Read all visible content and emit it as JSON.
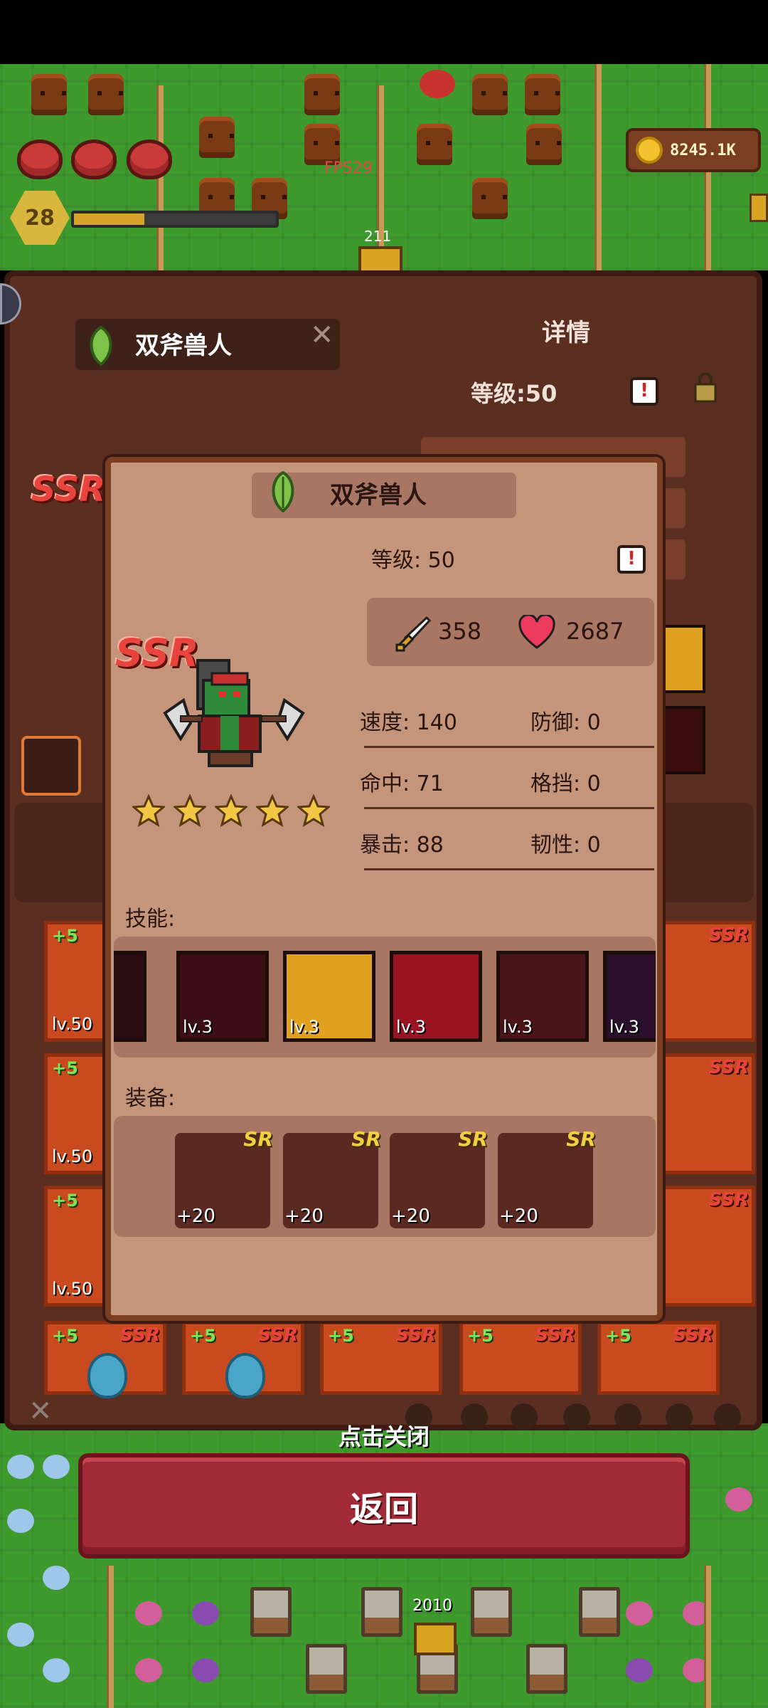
{
  "hud": {
    "fps": "FPS29",
    "player_level": "28",
    "xp_progress": 0.35,
    "coins": "8245.1K",
    "chest_count_top": "211",
    "chest_count_bottom": "2010"
  },
  "back_dialog": {
    "name": "双斧兽人",
    "close_glyph": "✕",
    "details_title": "详情",
    "level": "等级:50",
    "rarity": "SSR",
    "cards": [
      {
        "plus": "+5",
        "lv": "lv.50",
        "rarity": "SSR"
      },
      {
        "plus": "+5",
        "lv": "lv.50",
        "rarity": "SSR"
      },
      {
        "plus": "+5",
        "lv": "lv.50",
        "rarity": "SSR"
      }
    ],
    "bottom_cards": [
      {
        "plus": "+5",
        "rarity": "SSR"
      },
      {
        "plus": "+5",
        "rarity": "SSR"
      },
      {
        "plus": "+5",
        "rarity": "SSR"
      },
      {
        "plus": "+5",
        "rarity": "SSR"
      },
      {
        "plus": "+5",
        "rarity": "SSR"
      }
    ],
    "filter_close": "✕"
  },
  "hero_card": {
    "name": "双斧兽人",
    "rarity": "SSR",
    "level": "等级: 50",
    "info_glyph": "!",
    "attack": "358",
    "hp": "2687",
    "stars": 5,
    "stats": {
      "speed": "速度: 140",
      "defense": "防御: 0",
      "hit": "命中: 71",
      "block": "格挡: 0",
      "crit": "暴击: 88",
      "toughness": "韧性: 0"
    },
    "skills_label": "技能:",
    "skills": [
      {
        "lv": "lv.3",
        "icon": "blood-blade-icon"
      },
      {
        "lv": "lv.3",
        "icon": "sword-plus-icon"
      },
      {
        "lv": "lv.3",
        "icon": "blood-pillar-icon"
      },
      {
        "lv": "lv.3",
        "icon": "helmet-icon"
      },
      {
        "lv": "lv.3",
        "icon": "purple-vortex-icon"
      }
    ],
    "equip_label": "装备:",
    "equipment": [
      {
        "rarity": "SR",
        "plus": "+20",
        "icon": "bow-icon"
      },
      {
        "rarity": "SR",
        "plus": "+20",
        "icon": "blade-icon"
      },
      {
        "rarity": "SR",
        "plus": "+20",
        "icon": "ring-icon"
      },
      {
        "rarity": "SR",
        "plus": "+20",
        "icon": "ring-icon"
      }
    ]
  },
  "footer": {
    "tap_to_close": "点击关闭",
    "back": "返回"
  },
  "colors": {
    "card_bg": "#c4957a",
    "card_border": "#7a3f22",
    "panel_bg": "#5a2e20",
    "ssr_red": "#e6443c",
    "sr_gold": "#f0d040",
    "back_button": "#a12c38",
    "grass": "#3f9a2e"
  }
}
